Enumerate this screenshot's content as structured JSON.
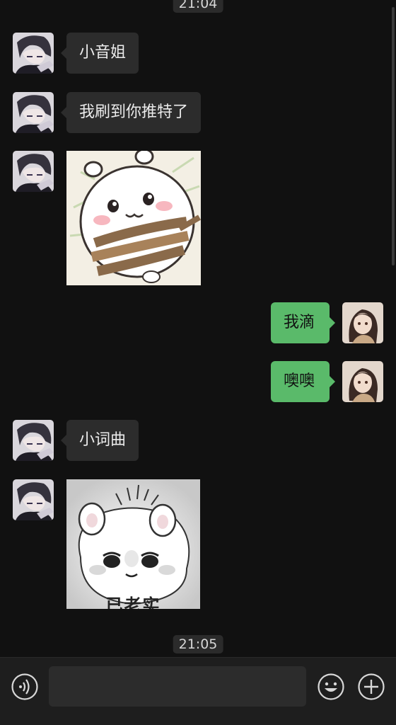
{
  "timestamps": {
    "top": "21:04",
    "bottom": "21:05"
  },
  "messages": [
    {
      "side": "in",
      "type": "text",
      "text": "小音姐"
    },
    {
      "side": "in",
      "type": "text",
      "text": "我刷到你推特了"
    },
    {
      "side": "in",
      "type": "sticker",
      "sticker": "hamster-tied-with-rope"
    },
    {
      "side": "out",
      "type": "text",
      "text": "我滴"
    },
    {
      "side": "out",
      "type": "text",
      "text": "噢噢"
    },
    {
      "side": "in",
      "type": "text",
      "text": "小词曲"
    },
    {
      "side": "in",
      "type": "sticker",
      "sticker": "fluffy-hamster",
      "caption": "已老实"
    }
  ],
  "input": {
    "value": "",
    "placeholder": ""
  },
  "icons": {
    "voice": "voice-icon",
    "emoji": "emoji-icon",
    "more": "plus-icon"
  },
  "colors": {
    "background": "#111111",
    "incoming_bubble": "#2c2c2c",
    "outgoing_bubble": "#5aba6a",
    "input_bar": "#1e1e1e"
  }
}
